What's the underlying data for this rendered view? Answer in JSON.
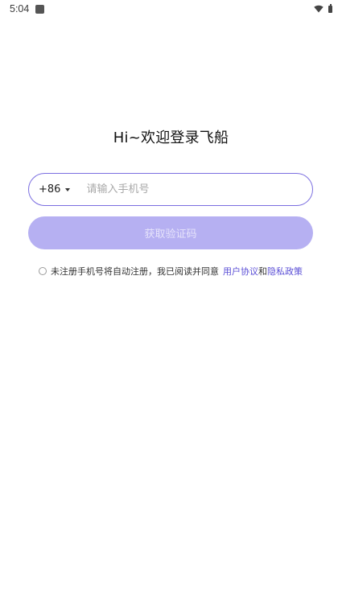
{
  "status_bar": {
    "time": "5:04",
    "icons": [
      "app-notification-icon",
      "wifi-icon",
      "battery-icon"
    ]
  },
  "login": {
    "title": "Hi~欢迎登录飞船",
    "country_code": "+86",
    "phone_placeholder": "请输入手机号",
    "submit_label": "获取验证码",
    "agreement": {
      "text": "未注册手机号将自动注册，我已阅读并同意",
      "user_agreement": "用户协议",
      "and": "和",
      "privacy_policy": "隐私政策"
    }
  },
  "colors": {
    "accent": "#7b6ee0",
    "button_bg": "#b6b0f2",
    "link": "#5b4fd6"
  }
}
